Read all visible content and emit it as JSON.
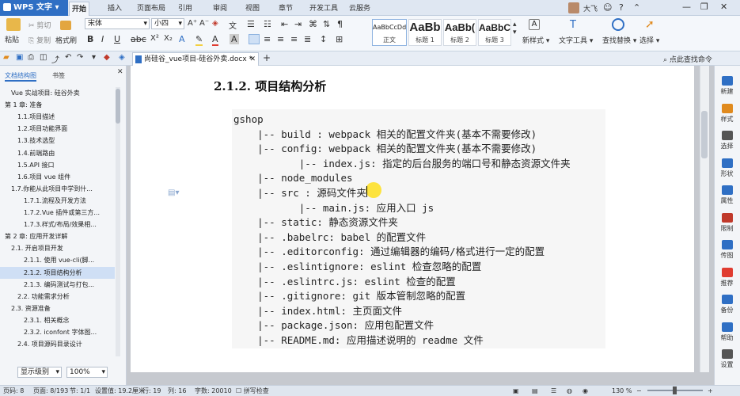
{
  "titlebar": {
    "app_name": "WPS 文字",
    "menu_tabs": [
      "开始",
      "插入",
      "页面布局",
      "引用",
      "审阅",
      "视图",
      "章节",
      "开发工具",
      "云服务"
    ],
    "user_name": "大飞"
  },
  "ribbon": {
    "paste": "粘贴",
    "cut": "剪切",
    "copy": "复制",
    "format_painter": "格式刷",
    "font_name": "宋体",
    "font_size": "小四",
    "style_samples": [
      {
        "preview": "AaBbCcDd",
        "label": "正文"
      },
      {
        "preview": "AaBb",
        "label": "标题 1"
      },
      {
        "preview": "AaBb(",
        "label": "标题 2"
      },
      {
        "preview": "AaBbC",
        "label": "标题 3"
      }
    ],
    "new_style": "新样式",
    "text_tools": "文字工具",
    "find_replace": "查找替换",
    "select": "选择"
  },
  "tabbar": {
    "doc_tab": "尚硅谷_vue项目-硅谷外卖.docx *",
    "search_hint": "点此查找命令"
  },
  "sidebar": {
    "tab_outline": "文档结构图",
    "tab_bookmark": "书签",
    "items": [
      {
        "text": "Vue 实战项目: 硅谷外卖",
        "indent": 1,
        "selected": false
      },
      {
        "text": "第 1 章: 准备",
        "indent": 0,
        "selected": false
      },
      {
        "text": "1.1.项目描述",
        "indent": 2,
        "selected": false
      },
      {
        "text": "1.2.项目功能界面",
        "indent": 2,
        "selected": false
      },
      {
        "text": "1.3.技术选型",
        "indent": 2,
        "selected": false
      },
      {
        "text": "1.4.前端路由",
        "indent": 2,
        "selected": false
      },
      {
        "text": "1.5.API 接口",
        "indent": 2,
        "selected": false
      },
      {
        "text": "1.6.项目 vue 组件",
        "indent": 2,
        "selected": false
      },
      {
        "text": "1.7.你能从此项目中学到什...",
        "indent": 1,
        "selected": false
      },
      {
        "text": "1.7.1.流程及开发方法",
        "indent": 3,
        "selected": false
      },
      {
        "text": "1.7.2.Vue 插件或第三方...",
        "indent": 3,
        "selected": false
      },
      {
        "text": "1.7.3.样式/布局/效果相...",
        "indent": 3,
        "selected": false
      },
      {
        "text": "第 2 章: 应用开发详解",
        "indent": 0,
        "selected": false
      },
      {
        "text": "2.1. 开启项目开发",
        "indent": 1,
        "selected": false
      },
      {
        "text": "2.1.1. 使用 vue-cli(脚...",
        "indent": 3,
        "selected": false
      },
      {
        "text": "2.1.2. 项目结构分析",
        "indent": 3,
        "selected": true
      },
      {
        "text": "2.1.3. 编码测试与打包...",
        "indent": 3,
        "selected": false
      },
      {
        "text": "2.2. 功能需求分析",
        "indent": 2,
        "selected": false
      },
      {
        "text": "2.3. 资源准备",
        "indent": 1,
        "selected": false
      },
      {
        "text": "2.3.1. 相关概念",
        "indent": 3,
        "selected": false
      },
      {
        "text": "2.3.2. iconfont 字体图...",
        "indent": 3,
        "selected": false
      },
      {
        "text": "2.4. 项目源码目录设计",
        "indent": 2,
        "selected": false
      }
    ],
    "level_select": "显示级别",
    "zoom_select": "100%"
  },
  "document": {
    "heading": "2.1.2. 项目结构分析",
    "code_lines": [
      "gshop",
      "    |-- build : webpack 相关的配置文件夹(基本不需要修改)",
      "    |-- config: webpack 相关的配置文件夹(基本不需要修改)",
      "           |-- index.js: 指定的后台服务的端口号和静态资源文件夹",
      "    |-- node_modules",
      "    |-- src : 源码文件夹",
      "           |-- main.js: 应用入口 js",
      "    |-- static: 静态资源文件夹",
      "    |-- .babelrc: babel 的配置文件",
      "    |-- .editorconfig: 通过编辑器的编码/格式进行一定的配置",
      "    |-- .eslintignore: eslint 检查忽略的配置",
      "    |-- .eslintrc.js: eslint 检查的配置",
      "    |-- .gitignore: git 版本管制忽略的配置",
      "    |-- index.html: 主页面文件",
      "    |-- package.json: 应用包配置文件",
      "    |-- README.md: 应用描述说明的 readme 文件"
    ]
  },
  "rightpane": [
    "新建",
    "样式",
    "选择",
    "形状",
    "属性",
    "限制",
    "传图",
    "推荐",
    "备份",
    "帮助",
    "设置"
  ],
  "statusbar": {
    "page": "页码: 8",
    "pages": "页面: 8/193",
    "section": "节: 1/1",
    "setting": "设置值: 19.2厘米",
    "row": "行: 19",
    "col": "列: 16",
    "words": "字数: 20010",
    "spell": "拼写检查",
    "zoom": "130 %"
  }
}
